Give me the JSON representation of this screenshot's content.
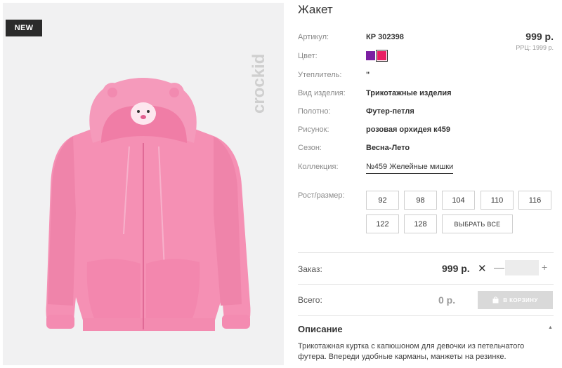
{
  "badge": "NEW",
  "brand": "crockid",
  "product": {
    "title": "Жакет",
    "price": "999 р.",
    "rrp": "РРЦ: 1999 р.",
    "attributes": [
      {
        "label": "Артикул:",
        "value": "КР 302398"
      },
      {
        "label": "Цвет:",
        "value": ""
      },
      {
        "label": "Утеплитель:",
        "value": "\""
      },
      {
        "label": "Вид изделия:",
        "value": "Трикотажные изделия"
      },
      {
        "label": "Полотно:",
        "value": "Футер-петля"
      },
      {
        "label": "Рисунок:",
        "value": "розовая орхидея к459"
      },
      {
        "label": "Сезон:",
        "value": "Весна-Лето"
      },
      {
        "label": "Коллекция:",
        "value": "№459 Желейные мишки"
      }
    ],
    "colors": [
      "#7b1fa2",
      "#e91e63"
    ]
  },
  "sizes": {
    "label": "Рост/размер:",
    "options": [
      "92",
      "98",
      "104",
      "110",
      "116",
      "122",
      "128"
    ],
    "select_all": "ВЫБРАТЬ ВСЕ"
  },
  "order": {
    "label": "Заказ:",
    "price": "999 р.",
    "times": "✕",
    "minus": "—",
    "plus": "+",
    "quantity": ""
  },
  "total": {
    "label": "Всего:",
    "value": "0 р.",
    "cart_button": "В КОРЗИНУ"
  },
  "description": {
    "title": "Описание",
    "text": "Трикотажная куртка с капюшоном для девочки из петельчатого футера. Впереди удобные карманы, манжеты на резинке."
  }
}
